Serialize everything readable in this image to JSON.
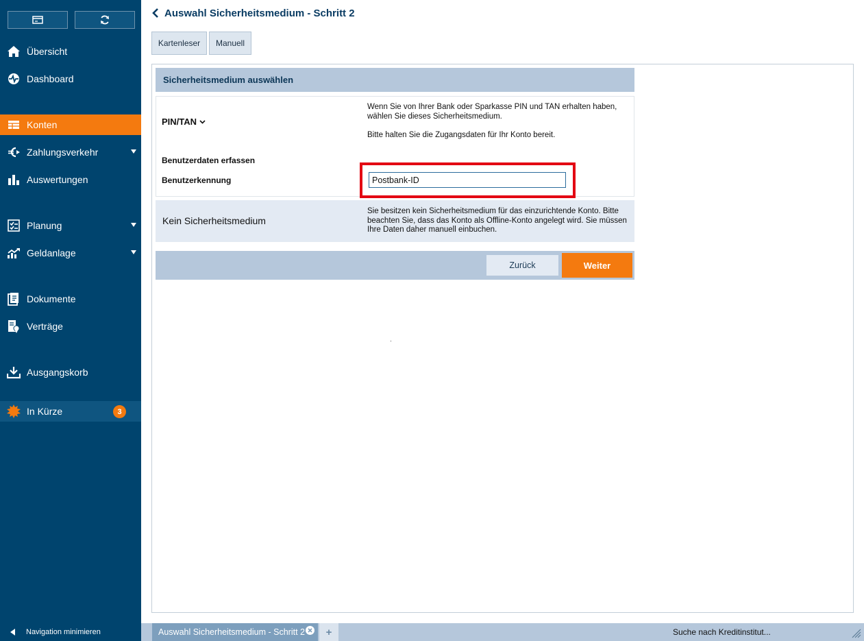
{
  "sidebar": {
    "items": [
      {
        "id": "uebersicht",
        "label": "Übersicht",
        "icon": "home-icon"
      },
      {
        "id": "dashboard",
        "label": "Dashboard",
        "icon": "pulse-icon"
      },
      {
        "id": "konten",
        "label": "Konten",
        "icon": "accounts-icon",
        "active": true
      },
      {
        "id": "zahlungsverkehr",
        "label": "Zahlungsverkehr",
        "icon": "euro-icon",
        "expandable": true
      },
      {
        "id": "auswertungen",
        "label": "Auswertungen",
        "icon": "bar-chart-icon"
      },
      {
        "id": "planung",
        "label": "Planung",
        "icon": "checklist-icon",
        "expandable": true
      },
      {
        "id": "geldanlage",
        "label": "Geldanlage",
        "icon": "trend-up-icon",
        "expandable": true
      },
      {
        "id": "dokumente",
        "label": "Dokumente",
        "icon": "documents-icon"
      },
      {
        "id": "vertraege",
        "label": "Verträge",
        "icon": "contracts-icon"
      },
      {
        "id": "ausgangskorb",
        "label": "Ausgangskorb",
        "icon": "outbox-icon"
      },
      {
        "id": "in-kuerze",
        "label": "In Kürze",
        "icon": "sun-badge-icon",
        "badge": "3"
      }
    ],
    "minimize_label": "Navigation minimieren"
  },
  "header": {
    "title": "Auswahl Sicherheitsmedium - Schritt 2"
  },
  "tabs": {
    "kartenleser": "Kartenleser",
    "manuell": "Manuell"
  },
  "section": {
    "title": "Sicherheitsmedium auswählen"
  },
  "pintan": {
    "title": "PIN/TAN",
    "desc_line1": "Wenn Sie von Ihrer Bank oder Sparkasse PIN und TAN erhalten haben, wählen Sie dieses Sicherheitsmedium.",
    "desc_line2": "Bitte halten Sie die Zugangsdaten für Ihr Konto bereit.",
    "benutzerdaten_label": "Benutzerdaten erfassen",
    "benutzerkennung_label": "Benutzerkennung",
    "benutzerkennung_value": "Postbank-ID"
  },
  "kein": {
    "title": "Kein Sicherheitsmedium",
    "desc": "Sie besitzen kein Sicherheitsmedium für das einzurichtende Konto. Bitte beachten Sie, dass das Konto als Offline-Konto angelegt wird. Sie müssen Ihre Daten daher manuell einbuchen."
  },
  "actions": {
    "zurueck": "Zurück",
    "weiter": "Weiter"
  },
  "bottom": {
    "open_tab": "Auswahl Sicherheitsmedium - Schritt 2",
    "add_tab": "+",
    "status": "Suche nach Kreditinstitut..."
  },
  "colors": {
    "sidebar_bg": "#00446e",
    "accent": "#f47a0f",
    "section_header": "#b5c7db",
    "highlight": "#e30613"
  }
}
